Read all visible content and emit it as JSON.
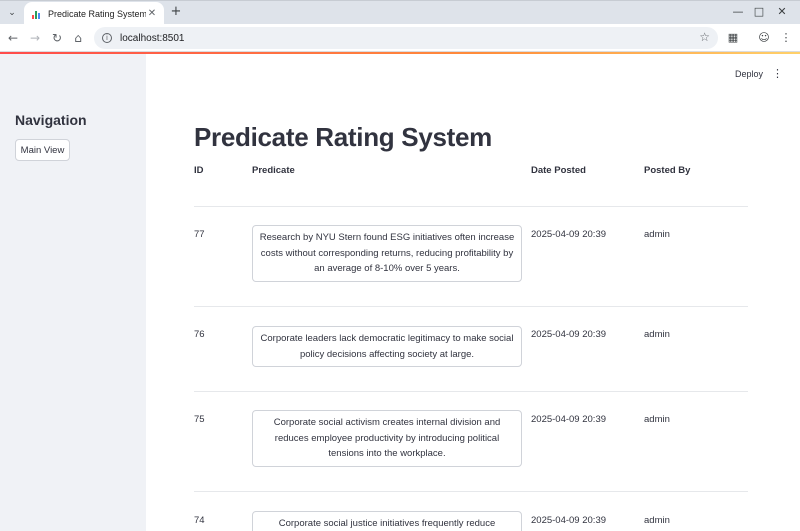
{
  "browser": {
    "tab_title": "Predicate Rating System",
    "url": "localhost:8501",
    "search_tabs_icon": "chevron-down-icon",
    "close_icon": "close-icon",
    "new_tab_icon": "plus-icon"
  },
  "sidebar": {
    "title": "Navigation",
    "main_view_label": "Main View"
  },
  "header": {
    "deploy_label": "Deploy"
  },
  "page": {
    "title": "Predicate Rating System",
    "columns": {
      "id": "ID",
      "predicate": "Predicate",
      "date_posted": "Date Posted",
      "posted_by": "Posted By"
    },
    "rows": [
      {
        "id": "77",
        "predicate": "Research by NYU Stern found ESG initiatives often increase costs without corresponding returns, reducing profitability by an average of 8-10% over 5 years.",
        "date_posted": "2025-04-09 20:39",
        "posted_by": "admin"
      },
      {
        "id": "76",
        "predicate": "Corporate leaders lack democratic legitimacy to make social policy decisions affecting society at large.",
        "date_posted": "2025-04-09 20:39",
        "posted_by": "admin"
      },
      {
        "id": "75",
        "predicate": "Corporate social activism creates internal division and reduces employee productivity by introducing political tensions into the workplace.",
        "date_posted": "2025-04-09 20:39",
        "posted_by": "admin"
      },
      {
        "id": "74",
        "predicate": "Corporate social justice initiatives frequently reduce",
        "date_posted": "2025-04-09 20:39",
        "posted_by": "admin"
      }
    ]
  },
  "colors": {
    "accent_gradient_start": "#ff4b4b",
    "accent_gradient_end": "#ffd16a",
    "sidebar_bg": "#f0f2f6",
    "text": "#31333f"
  }
}
